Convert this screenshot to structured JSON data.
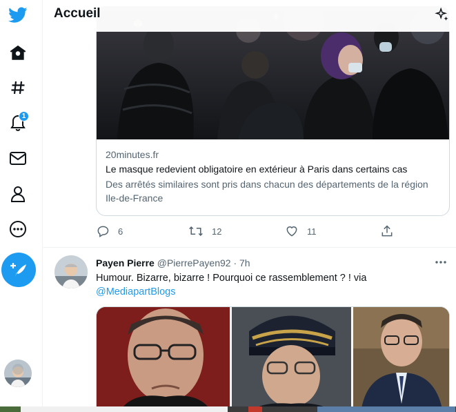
{
  "header": {
    "title": "Accueil"
  },
  "nav": {
    "notification_count": "1"
  },
  "tweet1": {
    "card": {
      "domain": "20minutes.fr",
      "title": "Le masque redevient obligatoire en extérieur à Paris dans certains cas",
      "description": "Des arrêtés similaires sont pris dans chacun des départements de la région Ile-de-France"
    },
    "actions": {
      "replies": "6",
      "retweets": "12",
      "likes": "11"
    }
  },
  "tweet2": {
    "name": "Payen Pierre",
    "handle": "@PierrePayen92",
    "time": "· 7h",
    "text": "Humour. Bizarre, bizarre ! Pourquoi ce rassemblement ? ! via",
    "mention": "@MediapartBlogs"
  },
  "colors": {
    "accent": "#1d9bf0",
    "text": "#0f1419",
    "muted": "#536471"
  },
  "icons": [
    "twitter-logo-icon",
    "home-icon",
    "hashtag-icon",
    "bell-icon",
    "mail-icon",
    "profile-icon",
    "more-circle-icon",
    "compose-tweet-icon",
    "sparkle-icon",
    "reply-icon",
    "retweet-icon",
    "like-icon",
    "share-icon",
    "more-dots-icon"
  ]
}
